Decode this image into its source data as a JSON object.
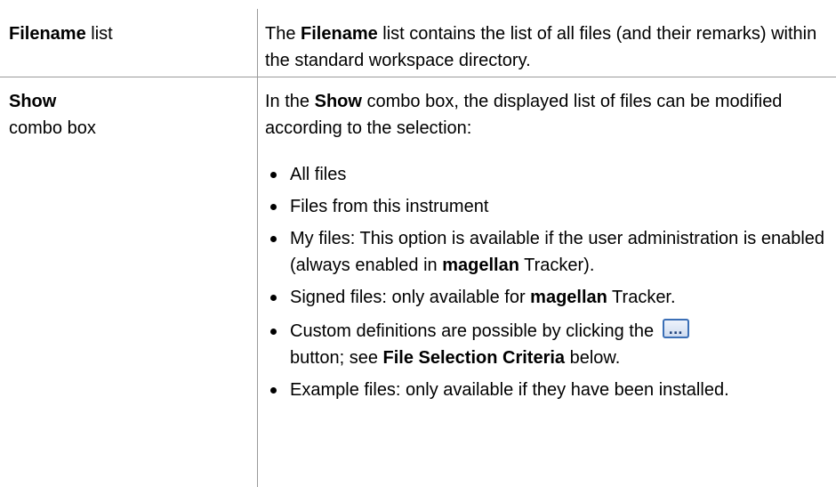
{
  "rows": [
    {
      "term_bold": "Filename",
      "term_rest": " list",
      "desc": {
        "pre": "The ",
        "bold": "Filename",
        "post": " list contains the list of all files (and their remarks) within the standard workspace directory."
      }
    },
    {
      "term_bold": "Show",
      "term_rest": "combo box",
      "desc": {
        "pre": "In the ",
        "bold": "Show",
        "post": " combo box, the displayed list of files can be modified according to the selection:"
      }
    }
  ],
  "bullets": {
    "b1": "All files",
    "b2": "Files from this instrument",
    "b3_pre": "My files: This option is available if the user administration is enabled (always enabled in ",
    "b3_bold": "magellan",
    "b3_post": " Tracker).",
    "b4_pre": "Signed files: only available for ",
    "b4_bold": "magellan",
    "b4_post": " Tracker.",
    "b5_pre": "Custom definitions are possible by clicking the ",
    "b5_icon": "...",
    "b5_mid": " button; see ",
    "b5_bold": "File Selection Criteria",
    "b5_post": " below.",
    "b6": "Example files: only available if they have been installed."
  },
  "icons": {
    "browse_button": "ellipsis-button-icon"
  },
  "colors": {
    "rule": "#9a9a9a",
    "icon_border": "#3b6fb6"
  }
}
